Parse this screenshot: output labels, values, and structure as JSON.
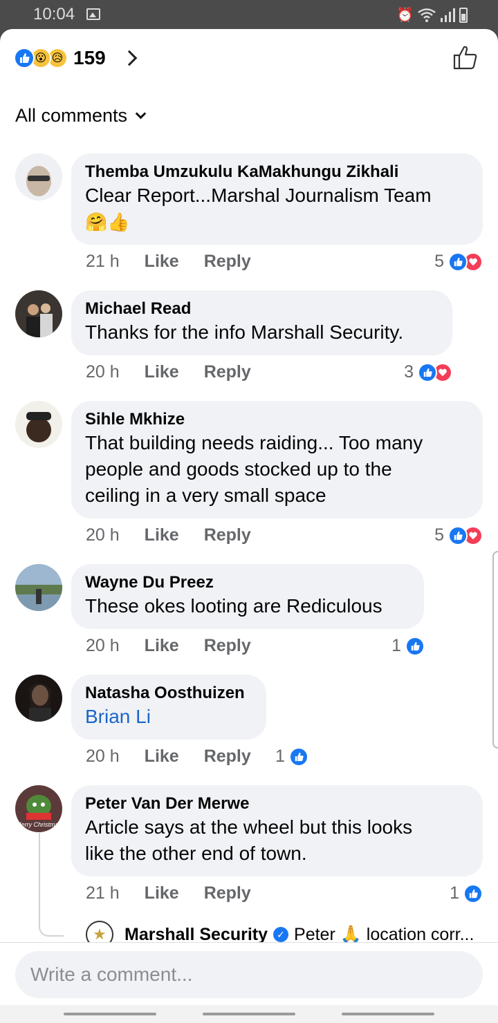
{
  "status_bar": {
    "time": "10:04"
  },
  "header": {
    "reaction_count": "159",
    "reactions": [
      "like",
      "wow",
      "sad"
    ]
  },
  "sort": {
    "label": "All comments"
  },
  "comments": [
    {
      "author": "Themba Umzukulu KaMakhungu Zikhali",
      "text": "Clear Report...Marshal Journalism Team",
      "emoji": "🤗👍",
      "time": "21 h",
      "like_label": "Like",
      "reply_label": "Reply",
      "reaction_count": "5",
      "reactions": [
        "like",
        "love"
      ]
    },
    {
      "author": "Michael Read",
      "text": "Thanks for the info Marshall Security.",
      "time": "20 h",
      "like_label": "Like",
      "reply_label": "Reply",
      "reaction_count": "3",
      "reactions": [
        "like",
        "love"
      ]
    },
    {
      "author": "Sihle Mkhize",
      "text_lines": [
        "That building needs raiding... Too many",
        "people and goods stocked up to the",
        "ceiling in a very small space"
      ],
      "time": "20 h",
      "like_label": "Like",
      "reply_label": "Reply",
      "reaction_count": "5",
      "reactions": [
        "like",
        "love"
      ]
    },
    {
      "author": "Wayne Du Preez",
      "text": "These okes looting are Rediculous",
      "time": "20 h",
      "like_label": "Like",
      "reply_label": "Reply",
      "reaction_count": "1",
      "reactions": [
        "like"
      ]
    },
    {
      "author": "Natasha Oosthuizen",
      "text": "Brian Li",
      "time": "20 h",
      "like_label": "Like",
      "reply_label": "Reply",
      "reaction_count": "1",
      "reactions": [
        "like"
      ]
    },
    {
      "author": "Peter Van Der Merwe",
      "text_lines": [
        "Article says at the wheel but this looks",
        "like the other end of town."
      ],
      "avatar_caption": "Merry Christmas",
      "time": "21 h",
      "like_label": "Like",
      "reply_label": "Reply",
      "reaction_count": "1",
      "reactions": [
        "like"
      ]
    }
  ],
  "reply_preview": {
    "author": "Marshall Security",
    "text": "Peter 🙏 location corr..."
  },
  "composer": {
    "placeholder": "Write a comment..."
  },
  "colors": {
    "facebook_blue": "#1877f2",
    "love_red": "#f33e58",
    "bubble_gray": "#f0f2f5"
  }
}
